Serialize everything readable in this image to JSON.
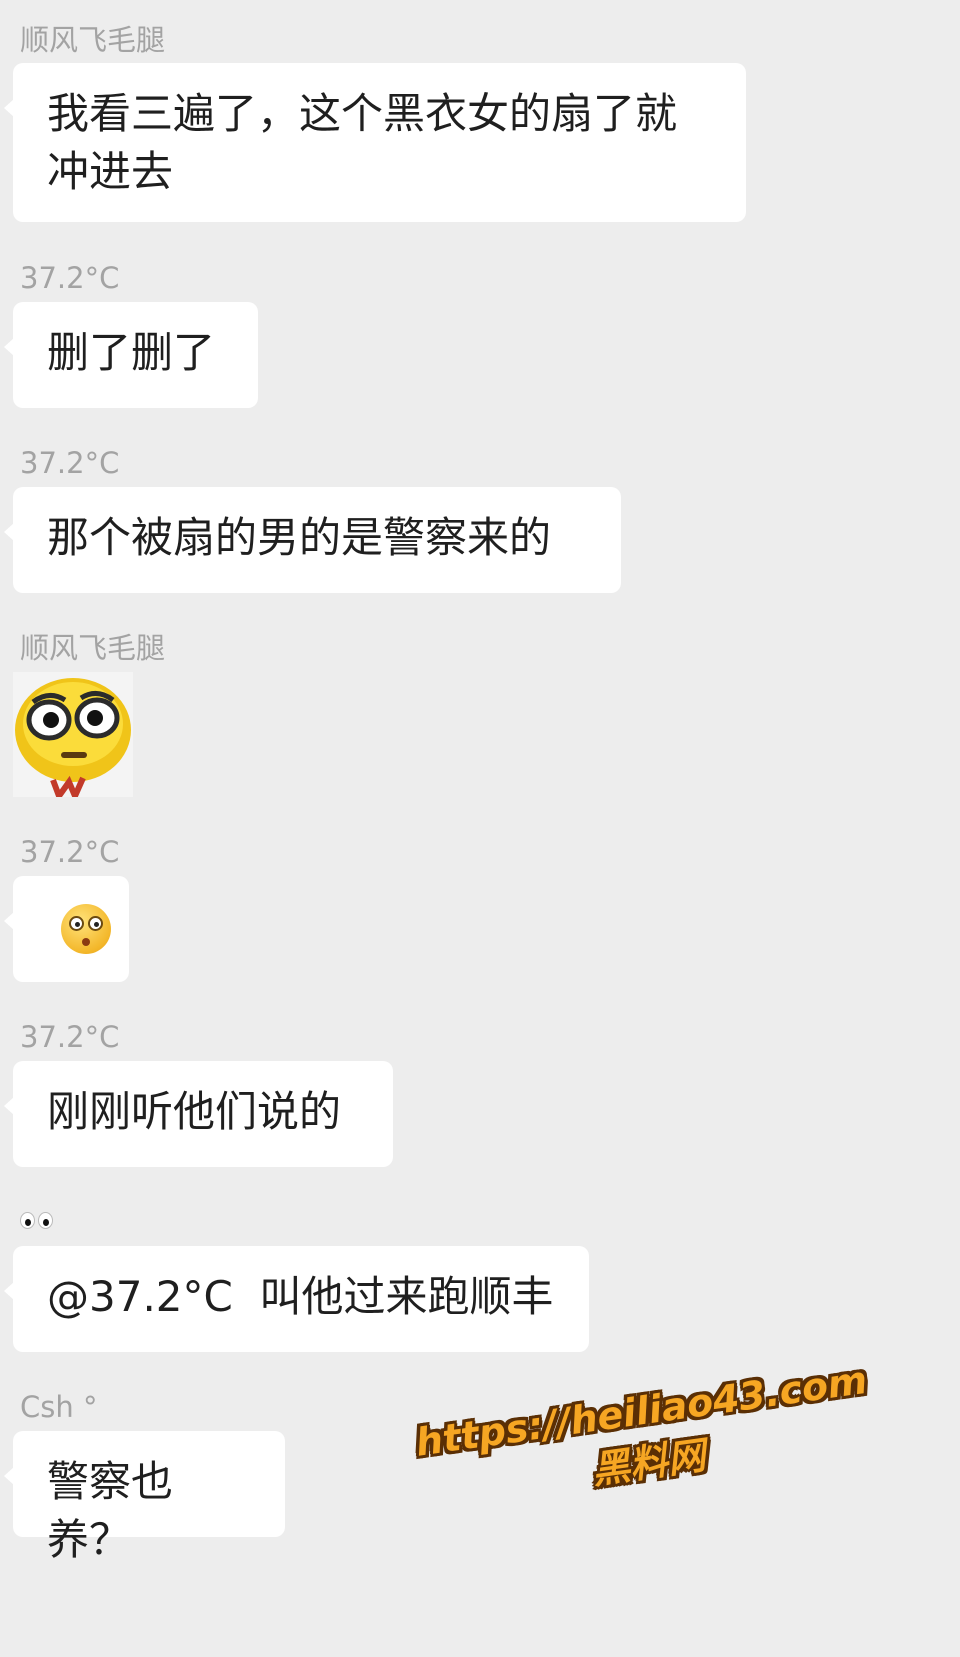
{
  "messages": [
    {
      "sender": "顺风飞毛腿",
      "text": "我看三遍了，这个黑衣女的扇了就\n冲进去"
    },
    {
      "sender": "37.2°C",
      "text": "删了删了"
    },
    {
      "sender": "37.2°C",
      "text": "那个被扇的男的是警察来的"
    },
    {
      "sender": "顺风飞毛腿",
      "sticker": "staring-yellow-face-sticker"
    },
    {
      "sender": "37.2°C",
      "emoji": "flushed-face-icon"
    },
    {
      "sender": "37.2°C",
      "text": "刚刚听他们说的"
    },
    {
      "sender_emoji": "eyes-icon",
      "text": "@37.2°C  叫他过来跑顺丰"
    },
    {
      "sender": "Csh °",
      "text": "警察也养？"
    }
  ],
  "watermark": {
    "line1": "https://heiliao43.com",
    "line2": "黑料网"
  },
  "colors": {
    "background": "#ededed",
    "bubble": "#ffffff",
    "sender": "#a3a3a3",
    "watermark": "#f6a623"
  }
}
